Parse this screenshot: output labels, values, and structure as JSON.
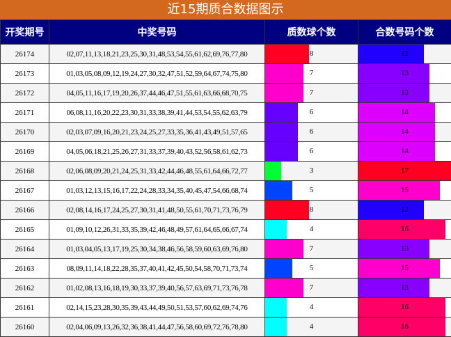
{
  "title": "近15期质合数据图示",
  "headers": [
    "开奖期号",
    "中奖号码",
    "质数球个数",
    "合数号码个数"
  ],
  "bar_max": 17,
  "colors": {
    "title_bg": "#d2691e",
    "header_bg": "#000080",
    "bar": {
      "3": "#00ff33",
      "4": "#00ffff",
      "5": "#0044ff",
      "6": "#6600ff",
      "7": "#ff00cc",
      "8": "#ff0022",
      "12": "#2200ff",
      "13": "#8800ff",
      "14": "#dd00ff",
      "15": "#ff00cc",
      "16": "#ff0066",
      "17": "#ff0022"
    }
  },
  "rows": [
    {
      "period": "26174",
      "numbers": "02,07,11,13,18,21,23,25,30,31,48,53,54,55,61,62,69,76,77,80",
      "prime": "8",
      "composite": "12"
    },
    {
      "period": "26173",
      "numbers": "01,03,05,08,09,12,19,24,27,30,32,47,51,52,59,64,67,74,75,80",
      "prime": "7",
      "composite": "13"
    },
    {
      "period": "26172",
      "numbers": "04,05,11,16,17,19,20,26,37,44,46,47,51,55,61,63,66,68,70,75",
      "prime": "7",
      "composite": "13"
    },
    {
      "period": "26171",
      "numbers": "06,08,11,16,20,22,23,30,31,33,38,39,41,44,53,54,55,62,63,79",
      "prime": "6",
      "composite": "14"
    },
    {
      "period": "26170",
      "numbers": "02,03,07,09,16,20,21,23,24,25,27,33,35,36,41,43,49,51,57,65",
      "prime": "6",
      "composite": "14"
    },
    {
      "period": "26169",
      "numbers": "04,05,06,18,21,25,26,27,31,33,37,39,40,43,52,56,58,61,62,73",
      "prime": "6",
      "composite": "14"
    },
    {
      "period": "26168",
      "numbers": "02,06,08,09,20,21,24,25,31,33,42,44,46,48,55,61,64,66,72,77",
      "prime": "3",
      "composite": "17"
    },
    {
      "period": "26167",
      "numbers": "01,03,12,13,15,16,17,22,24,28,33,34,35,40,45,47,54,66,68,74",
      "prime": "5",
      "composite": "15"
    },
    {
      "period": "26166",
      "numbers": "02,08,14,16,17,24,25,27,30,31,41,48,50,55,61,70,71,73,76,79",
      "prime": "8",
      "composite": "12"
    },
    {
      "period": "26165",
      "numbers": "01,09,10,12,26,31,33,35,39,42,46,48,49,57,61,64,65,66,67,74",
      "prime": "4",
      "composite": "16"
    },
    {
      "period": "26164",
      "numbers": "01,03,04,05,13,17,19,25,30,34,38,46,56,58,59,60,63,69,76,80",
      "prime": "7",
      "composite": "13"
    },
    {
      "period": "26163",
      "numbers": "08,09,11,14,18,22,28,35,37,40,41,42,45,50,54,58,70,71,73,74",
      "prime": "5",
      "composite": "15"
    },
    {
      "period": "26162",
      "numbers": "01,02,08,13,16,18,19,30,33,37,39,40,56,57,63,69,71,73,76,78",
      "prime": "7",
      "composite": "13"
    },
    {
      "period": "26161",
      "numbers": "02,14,15,23,28,30,35,39,43,44,49,50,51,53,57,60,62,69,74,76",
      "prime": "4",
      "composite": "16"
    },
    {
      "period": "26160",
      "numbers": "02,04,06,09,13,26,32,36,38,41,44,47,56,58,60,69,72,76,78,80",
      "prime": "4",
      "composite": "16"
    }
  ]
}
